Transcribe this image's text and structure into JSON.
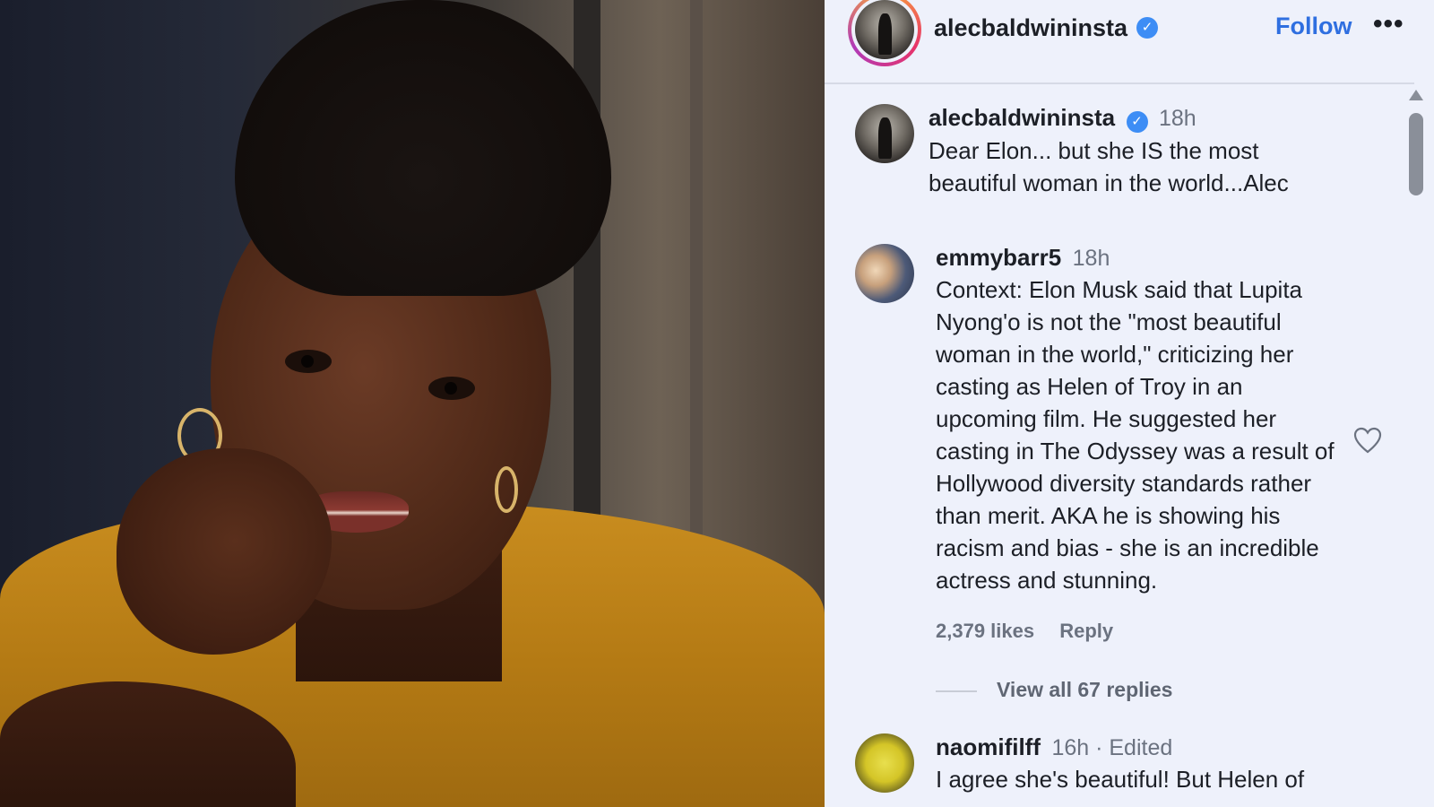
{
  "post": {
    "author": "alecbaldwininsta",
    "follow_label": "Follow",
    "more_label": "•••",
    "verified_mark": "✓"
  },
  "comments": [
    {
      "author": "alecbaldwininsta",
      "verified": true,
      "time": "18h",
      "text": "Dear Elon... but she IS the most beautiful woman in the world...Alec"
    },
    {
      "author": "emmybarr5",
      "time": "18h",
      "text": "Context: Elon Musk said that Lupita Nyong'o is not the \"most beautiful woman in the world,\" criticizing her casting as Helen of Troy in an upcoming film. He suggested her casting in The Odyssey was a result of Hollywood diversity standards rather than merit. AKA he is showing his racism and bias - she is an incredible actress and stunning.",
      "likes": "2,379 likes",
      "reply_label": "Reply",
      "view_replies": "View all 67 replies"
    },
    {
      "author": "naomifilff",
      "time": "16h · Edited",
      "text": "I agree she's beautiful! But Helen of"
    }
  ],
  "colors": {
    "panel_bg": "#eef1fb",
    "accent": "#2f6fe0",
    "verified": "#3d8df5"
  }
}
